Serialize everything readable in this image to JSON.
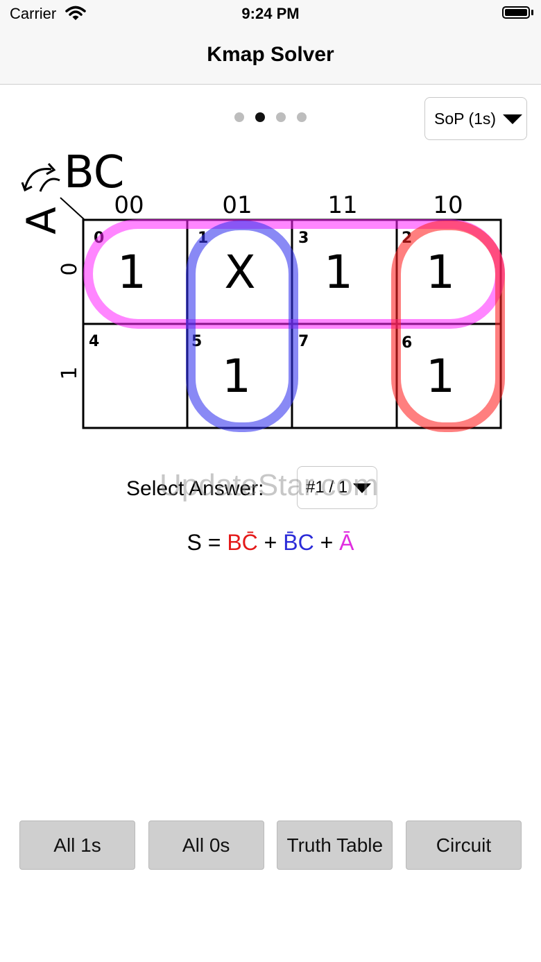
{
  "status": {
    "carrier": "Carrier",
    "time": "9:24 PM"
  },
  "nav": {
    "title": "Kmap Solver"
  },
  "pager": {
    "count": 4,
    "active": 2
  },
  "mode": {
    "selected": "SoP (1s)"
  },
  "kmap": {
    "col_var": "BC",
    "row_var": "A",
    "col_headers": [
      "00",
      "01",
      "11",
      "10"
    ],
    "row_headers": [
      "0",
      "1"
    ],
    "cells": [
      [
        {
          "index": "0",
          "value": "1"
        },
        {
          "index": "1",
          "value": "X"
        },
        {
          "index": "3",
          "value": "1"
        },
        {
          "index": "2",
          "value": "1"
        }
      ],
      [
        {
          "index": "4",
          "value": ""
        },
        {
          "index": "5",
          "value": "1"
        },
        {
          "index": "7",
          "value": ""
        },
        {
          "index": "6",
          "value": "1"
        }
      ]
    ],
    "group_colors": {
      "magenta": "#ff22ff",
      "blue": "#3333ee",
      "red": "#ff2222"
    }
  },
  "answer": {
    "label": "Select Answer:",
    "selected": "#1 / 1",
    "watermark": "UpdateStar.com"
  },
  "expression": {
    "prefix": "S = ",
    "term1": "BC̄",
    "plus1": " + ",
    "term2": "B̄C",
    "plus2": " + ",
    "term3": "Ā"
  },
  "buttons": {
    "all_ones": "All 1s",
    "all_zeros": "All 0s",
    "truth_table": "Truth Table",
    "circuit": "Circuit"
  }
}
